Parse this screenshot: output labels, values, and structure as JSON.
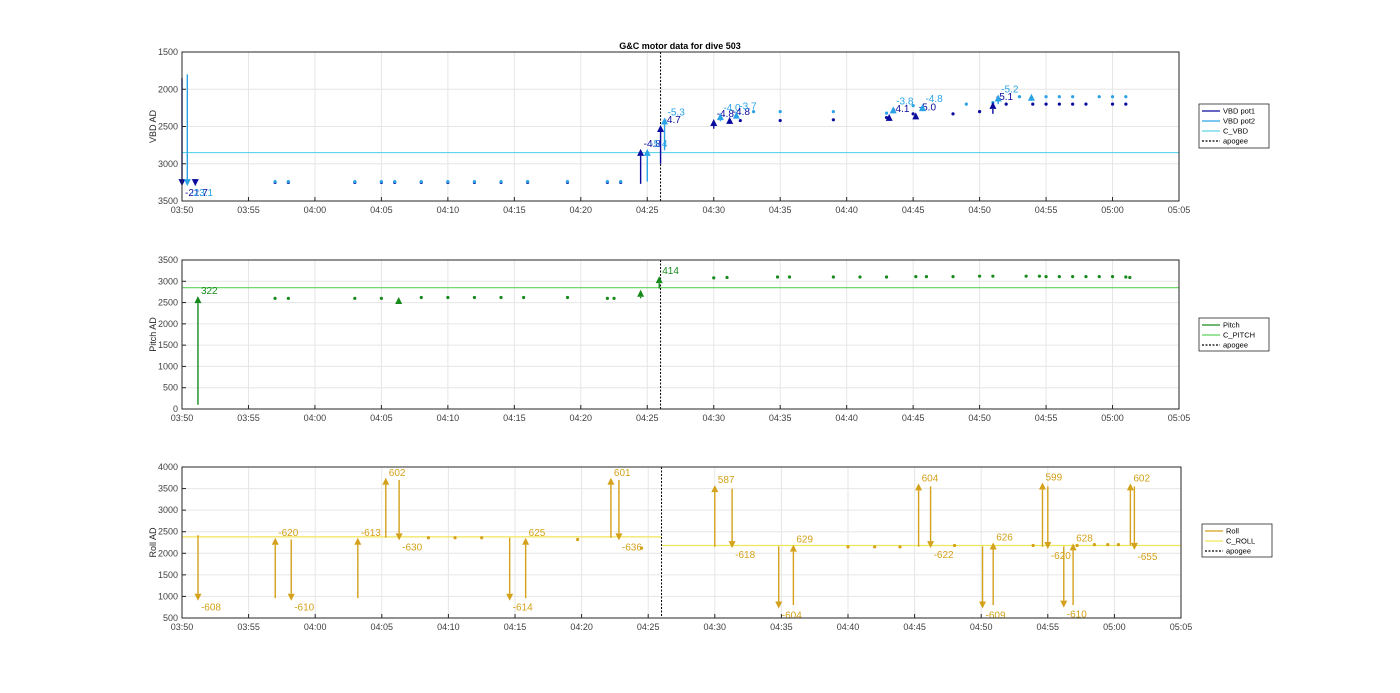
{
  "figure_title": "G&C motor data for dive 503",
  "colors": {
    "vbd_pot1": "#0a0a9e",
    "vbd_pot2": "#2aa3e6",
    "c_vbd": "#5fd3e8",
    "pitch": "#178a1c",
    "c_pitch": "#5ed45a",
    "roll": "#d4a11a",
    "c_roll": "#f0e65a",
    "apogee": "#000000",
    "grid": "#e6e6e6"
  },
  "chart_data": [
    {
      "type": "line",
      "ylabel": "VBD AD",
      "title": "G&C motor data for dive 503",
      "xlim": [
        "03:50",
        "05:05"
      ],
      "xticks": [
        "03:50",
        "03:55",
        "04:00",
        "04:05",
        "04:10",
        "04:15",
        "04:20",
        "04:25",
        "04:30",
        "04:35",
        "04:40",
        "04:45",
        "04:50",
        "04:55",
        "05:00",
        "05:05"
      ],
      "ylim": [
        1500,
        3500
      ],
      "yticks": [
        1500,
        2000,
        2500,
        3000,
        3500
      ],
      "y_reversed": true,
      "grid": true,
      "legend_position": "right",
      "legend": [
        "VBD pot1",
        "VBD pot2",
        "C_VBD",
        "apogee"
      ],
      "apogee_time": "04:26",
      "reference_line": {
        "name": "C_VBD",
        "value": 2850
      },
      "series": [
        {
          "name": "VBD pot1",
          "color_key": "vbd_pot1",
          "x": [
            "03:57",
            "03:58",
            "04:03",
            "04:05",
            "04:06",
            "04:08",
            "04:10",
            "04:12",
            "04:14",
            "04:16",
            "04:19",
            "04:22",
            "04:23",
            "04:32",
            "04:35",
            "04:39",
            "04:43",
            "04:45",
            "04:48",
            "04:50",
            "04:52",
            "04:54",
            "04:55",
            "04:56",
            "04:57",
            "04:58",
            "05:00",
            "05:01"
          ],
          "y": [
            3250,
            3250,
            3250,
            3250,
            3250,
            3250,
            3250,
            3250,
            3250,
            3250,
            3250,
            3250,
            3250,
            2420,
            2420,
            2410,
            2380,
            2330,
            2330,
            2300,
            2200,
            2200,
            2200,
            2200,
            2200,
            2200,
            2200,
            2200
          ]
        },
        {
          "name": "VBD pot2",
          "color_key": "vbd_pot2",
          "x": [
            "03:57",
            "03:58",
            "04:03",
            "04:05",
            "04:06",
            "04:08",
            "04:10",
            "04:12",
            "04:14",
            "04:16",
            "04:19",
            "04:22",
            "04:23",
            "04:33",
            "04:35",
            "04:39",
            "04:43",
            "04:45",
            "04:49",
            "04:51",
            "04:53",
            "04:55",
            "04:56",
            "04:57",
            "04:59",
            "05:00",
            "05:01"
          ],
          "y": [
            3240,
            3240,
            3240,
            3240,
            3240,
            3240,
            3240,
            3240,
            3240,
            3240,
            3240,
            3240,
            3240,
            2300,
            2300,
            2300,
            2320,
            2220,
            2200,
            2180,
            2100,
            2100,
            2100,
            2100,
            2100,
            2100,
            2100
          ]
        }
      ],
      "moves": [
        {
          "series": "VBD pot1",
          "x": "03:50",
          "from": 1850,
          "to": 3300,
          "label": "-21.7"
        },
        {
          "series": "VBD pot2",
          "x": "03:50.4",
          "from": 1800,
          "to": 3300,
          "label": "-23.1"
        },
        {
          "series": "VBD pot1",
          "x": "03:51",
          "from": 3250,
          "to": 3300,
          "label": ""
        },
        {
          "series": "VBD pot1",
          "x": "04:24.5",
          "from": 3270,
          "to": 2800,
          "label": "-4.8"
        },
        {
          "series": "VBD pot2",
          "x": "04:25",
          "from": 3240,
          "to": 2800,
          "label": "-5.4"
        },
        {
          "series": "VBD pot1",
          "x": "04:26",
          "from": 3000,
          "to": 2480,
          "label": "-4.7"
        },
        {
          "series": "VBD pot2",
          "x": "04:26.3",
          "from": 2820,
          "to": 2380,
          "label": "-5.3"
        },
        {
          "series": "VBD pot1",
          "x": "04:30",
          "from": 2530,
          "to": 2400,
          "label": "-4.8"
        },
        {
          "series": "VBD pot2",
          "x": "04:30.5",
          "from": 2430,
          "to": 2320,
          "label": "-4.0"
        },
        {
          "series": "VBD pot1",
          "x": "04:31.2",
          "from": 2450,
          "to": 2370,
          "label": "-4.8"
        },
        {
          "series": "VBD pot2",
          "x": "04:31.7",
          "from": 2380,
          "to": 2300,
          "label": "-3.7"
        },
        {
          "series": "VBD pot1",
          "x": "04:43.2",
          "from": 2400,
          "to": 2330,
          "label": "-4.1"
        },
        {
          "series": "VBD pot2",
          "x": "04:43.5",
          "from": 2320,
          "to": 2230,
          "label": "-3.8"
        },
        {
          "series": "VBD pot1",
          "x": "04:45.2",
          "from": 2380,
          "to": 2310,
          "label": "-5.0"
        },
        {
          "series": "VBD pot2",
          "x": "04:45.7",
          "from": 2280,
          "to": 2200,
          "label": "-4.8"
        },
        {
          "series": "VBD pot1",
          "x": "04:51",
          "from": 2330,
          "to": 2170,
          "label": "-5.1"
        },
        {
          "series": "VBD pot2",
          "x": "04:51.4",
          "from": 2200,
          "to": 2070,
          "label": "-5.2"
        },
        {
          "series": "VBD pot2",
          "x": "04:53.9",
          "from": 2120,
          "to": 2060,
          "label": ""
        }
      ]
    },
    {
      "type": "line",
      "ylabel": "Pitch AD",
      "xlim": [
        "03:50",
        "05:05"
      ],
      "xticks": [
        "03:50",
        "03:55",
        "04:00",
        "04:05",
        "04:10",
        "04:15",
        "04:20",
        "04:25",
        "04:30",
        "04:35",
        "04:40",
        "04:45",
        "04:50",
        "04:55",
        "05:00",
        "05:05"
      ],
      "ylim": [
        0,
        3500
      ],
      "yticks": [
        0,
        500,
        1000,
        1500,
        2000,
        2500,
        3000,
        3500
      ],
      "grid": true,
      "legend_position": "right",
      "legend": [
        "Pitch",
        "C_PITCH",
        "apogee"
      ],
      "apogee_time": "04:26",
      "reference_line": {
        "name": "C_PITCH",
        "value": 2850
      },
      "series": [
        {
          "name": "Pitch",
          "color_key": "pitch",
          "x": [
            "03:57",
            "03:58",
            "04:03",
            "04:05",
            "04:08",
            "04:10",
            "04:12",
            "04:14",
            "04:15.7",
            "04:19",
            "04:22",
            "04:22.5",
            "04:30",
            "04:31",
            "04:34.8",
            "04:35.7",
            "04:39",
            "04:41",
            "04:43",
            "04:45.2",
            "04:46",
            "04:48",
            "04:50",
            "04:51",
            "04:53.5",
            "04:54.5",
            "04:55",
            "04:56",
            "04:57",
            "04:58",
            "04:59",
            "05:00",
            "05:01",
            "05:01.3"
          ],
          "y": [
            2600,
            2600,
            2600,
            2600,
            2620,
            2620,
            2620,
            2620,
            2620,
            2620,
            2600,
            2600,
            3080,
            3090,
            3100,
            3100,
            3100,
            3100,
            3100,
            3110,
            3110,
            3110,
            3120,
            3120,
            3120,
            3120,
            3110,
            3110,
            3110,
            3110,
            3110,
            3110,
            3100,
            3090
          ]
        }
      ],
      "moves": [
        {
          "series": "Pitch",
          "x": "03:51.2",
          "from": 100,
          "to": 2650,
          "label": "322"
        },
        {
          "series": "Pitch",
          "x": "04:06.3",
          "from": 2600,
          "to": 2630,
          "label": ""
        },
        {
          "series": "Pitch",
          "x": "04:24.5",
          "from": 2600,
          "to": 2800,
          "label": ""
        },
        {
          "series": "Pitch",
          "x": "04:25.9",
          "from": 2830,
          "to": 3120,
          "label": "414"
        }
      ]
    },
    {
      "type": "line",
      "ylabel": "Roll AD",
      "xlim": [
        "03:50",
        "05:05"
      ],
      "xticks": [
        "03:50",
        "03:55",
        "04:00",
        "04:05",
        "04:10",
        "04:15",
        "04:20",
        "04:25",
        "04:30",
        "04:35",
        "04:40",
        "04:45",
        "04:50",
        "04:55",
        "05:00",
        "05:05"
      ],
      "ylim": [
        500,
        4000
      ],
      "yticks": [
        500,
        1000,
        1500,
        2000,
        2500,
        3000,
        3500,
        4000
      ],
      "grid": true,
      "legend_position": "right",
      "legend": [
        "Roll",
        "C_ROLL",
        "apogee"
      ],
      "apogee_time": "04:26",
      "reference_line": {
        "name": "C_ROLL",
        "segments": [
          {
            "from": "03:50",
            "to": "04:26",
            "value": 2380
          },
          {
            "from": "04:26",
            "to": "05:05",
            "value": 2180
          }
        ]
      },
      "series": [
        {
          "name": "Roll",
          "color_key": "roll",
          "x": [
            "04:08.5",
            "04:10.5",
            "04:12.5",
            "04:19.7",
            "04:24.5",
            "04:40",
            "04:42",
            "04:43.9",
            "04:48",
            "04:53.9",
            "04:57.2",
            "04:58.5",
            "04:59.5",
            "05:00.3"
          ],
          "y": [
            2360,
            2360,
            2360,
            2320,
            2120,
            2150,
            2150,
            2150,
            2180,
            2180,
            2180,
            2200,
            2200,
            2200
          ]
        }
      ],
      "moves": [
        {
          "series": "Roll",
          "x": "03:51.2",
          "from": 2420,
          "to": 900,
          "label": "-608"
        },
        {
          "series": "Roll",
          "x": "03:57",
          "from": 960,
          "to": 2360,
          "label": "-620"
        },
        {
          "series": "Roll",
          "x": "03:58.2",
          "from": 2320,
          "to": 900,
          "label": "-610"
        },
        {
          "series": "Roll",
          "x": "04:03.2",
          "from": 960,
          "to": 2360,
          "label": "-613"
        },
        {
          "series": "Roll",
          "x": "04:05.3",
          "from": 2360,
          "to": 3750,
          "label": "602"
        },
        {
          "series": "Roll",
          "x": "04:06.3",
          "from": 3700,
          "to": 2300,
          "label": "-630"
        },
        {
          "series": "Roll",
          "x": "04:14.6",
          "from": 2360,
          "to": 900,
          "label": "-614"
        },
        {
          "series": "Roll",
          "x": "04:15.8",
          "from": 960,
          "to": 2360,
          "label": "625"
        },
        {
          "series": "Roll",
          "x": "04:22.2",
          "from": 2360,
          "to": 3750,
          "label": "601"
        },
        {
          "series": "Roll",
          "x": "04:22.8",
          "from": 3700,
          "to": 2300,
          "label": "-636"
        },
        {
          "series": "Roll",
          "x": "04:30",
          "from": 2150,
          "to": 3580,
          "label": "587"
        },
        {
          "series": "Roll",
          "x": "04:31.3",
          "from": 3500,
          "to": 2120,
          "label": "-618"
        },
        {
          "series": "Roll",
          "x": "04:34.8",
          "from": 2160,
          "to": 720,
          "label": "-604"
        },
        {
          "series": "Roll",
          "x": "04:35.9",
          "from": 800,
          "to": 2200,
          "label": "629"
        },
        {
          "series": "Roll",
          "x": "04:45.3",
          "from": 2150,
          "to": 3620,
          "label": "604"
        },
        {
          "series": "Roll",
          "x": "04:46.2",
          "from": 3550,
          "to": 2120,
          "label": "-622"
        },
        {
          "series": "Roll",
          "x": "04:50.1",
          "from": 2160,
          "to": 720,
          "label": "-609"
        },
        {
          "series": "Roll",
          "x": "04:50.9",
          "from": 800,
          "to": 2250,
          "label": "626"
        },
        {
          "series": "Roll",
          "x": "04:54.6",
          "from": 2150,
          "to": 3640,
          "label": "599"
        },
        {
          "series": "Roll",
          "x": "04:55",
          "from": 3550,
          "to": 2100,
          "label": "-620"
        },
        {
          "series": "Roll",
          "x": "04:56.2",
          "from": 2160,
          "to": 740,
          "label": "-610"
        },
        {
          "series": "Roll",
          "x": "04:56.9",
          "from": 800,
          "to": 2230,
          "label": "628"
        },
        {
          "series": "Roll",
          "x": "05:01.2",
          "from": 2180,
          "to": 3620,
          "label": "602"
        },
        {
          "series": "Roll",
          "x": "05:01.5",
          "from": 3550,
          "to": 2080,
          "label": "-655"
        }
      ]
    }
  ]
}
